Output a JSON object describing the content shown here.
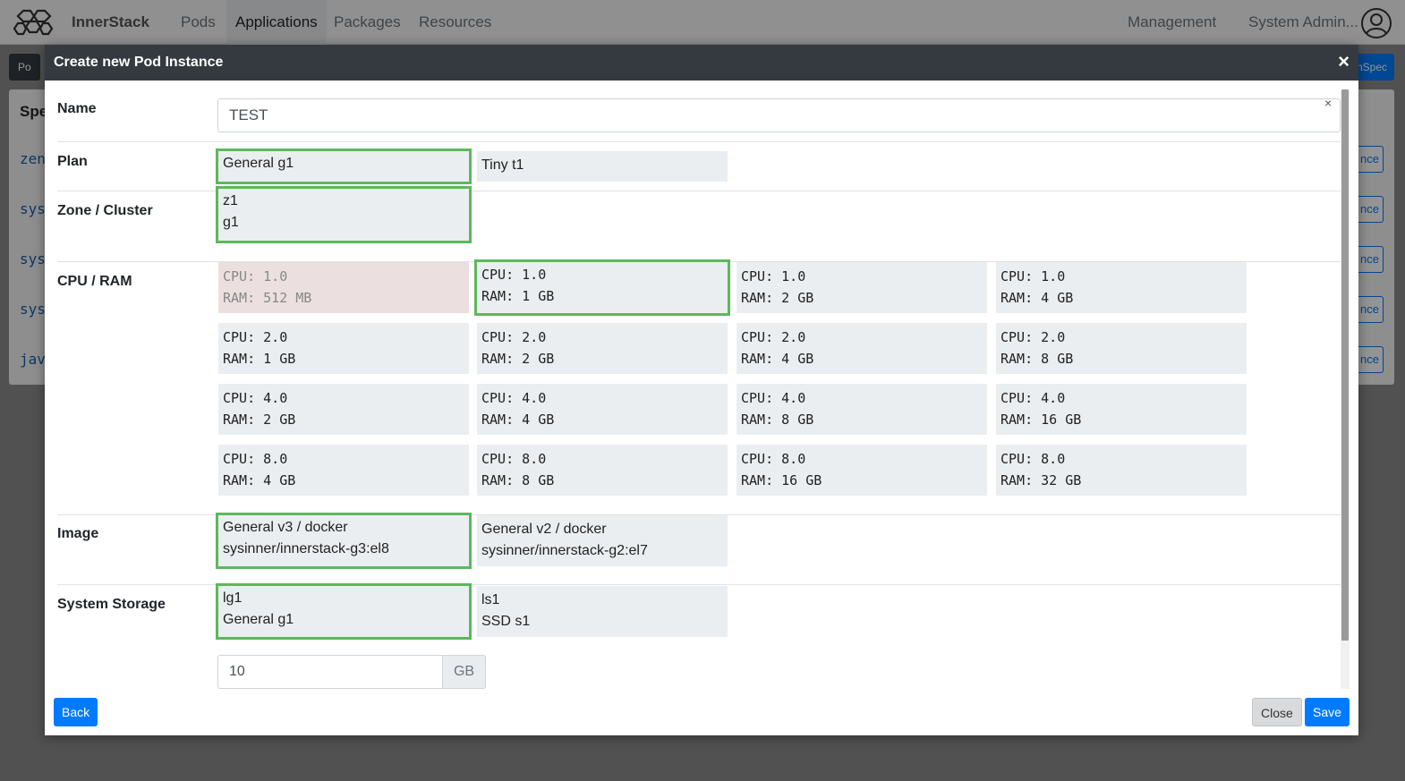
{
  "app": {
    "brand": "InnerStack",
    "nav": [
      "Pods",
      "Applications",
      "Packages",
      "Resources"
    ],
    "active_nav": "Applications",
    "right_nav": {
      "management": "Management",
      "user": "System Admin..."
    }
  },
  "background": {
    "chip_left": "Po",
    "chip_right": "nSpec",
    "section_head": "Spe",
    "rows": [
      "zen",
      "sys",
      "sys",
      "sys",
      "jav"
    ],
    "row_button": "nce"
  },
  "modal": {
    "title": "Create new Pod Instance",
    "close_glyph": "×",
    "name": {
      "label": "Name",
      "value": "TEST",
      "clear_glyph": "×"
    },
    "plan": {
      "label": "Plan",
      "options": [
        {
          "text": "General g1",
          "selected": true
        },
        {
          "text": "Tiny t1",
          "selected": false
        }
      ]
    },
    "zone": {
      "label": "Zone / Cluster",
      "options": [
        {
          "line1": "z1",
          "line2": "g1",
          "selected": true
        }
      ]
    },
    "cpu_ram": {
      "label": "CPU / RAM",
      "options": [
        {
          "cpu": "CPU: 1.0",
          "ram": "RAM: 512 MB",
          "state": "disabled"
        },
        {
          "cpu": "CPU: 1.0",
          "ram": "RAM: 1 GB",
          "state": "selected"
        },
        {
          "cpu": "CPU: 1.0",
          "ram": "RAM: 2 GB",
          "state": "normal"
        },
        {
          "cpu": "CPU: 1.0",
          "ram": "RAM: 4 GB",
          "state": "normal"
        },
        {
          "cpu": "CPU: 2.0",
          "ram": "RAM: 1 GB",
          "state": "normal"
        },
        {
          "cpu": "CPU: 2.0",
          "ram": "RAM: 2 GB",
          "state": "normal"
        },
        {
          "cpu": "CPU: 2.0",
          "ram": "RAM: 4 GB",
          "state": "normal"
        },
        {
          "cpu": "CPU: 2.0",
          "ram": "RAM: 8 GB",
          "state": "normal"
        },
        {
          "cpu": "CPU: 4.0",
          "ram": "RAM: 2 GB",
          "state": "normal"
        },
        {
          "cpu": "CPU: 4.0",
          "ram": "RAM: 4 GB",
          "state": "normal"
        },
        {
          "cpu": "CPU: 4.0",
          "ram": "RAM: 8 GB",
          "state": "normal"
        },
        {
          "cpu": "CPU: 4.0",
          "ram": "RAM: 16 GB",
          "state": "normal"
        },
        {
          "cpu": "CPU: 8.0",
          "ram": "RAM: 4 GB",
          "state": "normal"
        },
        {
          "cpu": "CPU: 8.0",
          "ram": "RAM: 8 GB",
          "state": "normal"
        },
        {
          "cpu": "CPU: 8.0",
          "ram": "RAM: 16 GB",
          "state": "normal"
        },
        {
          "cpu": "CPU: 8.0",
          "ram": "RAM: 32 GB",
          "state": "normal"
        }
      ]
    },
    "image": {
      "label": "Image",
      "options": [
        {
          "line1": "General v3 / docker",
          "line2": "sysinner/innerstack-g3:el8",
          "selected": true
        },
        {
          "line1": "General v2 / docker",
          "line2": "sysinner/innerstack-g2:el7",
          "selected": false
        }
      ]
    },
    "storage": {
      "label": "System Storage",
      "options": [
        {
          "line1": "lg1",
          "line2": "General g1",
          "selected": true
        },
        {
          "line1": "ls1",
          "line2": "SSD s1",
          "selected": false
        }
      ],
      "size_value": "10",
      "size_unit": "GB"
    },
    "footer": {
      "back": "Back",
      "close": "Close",
      "save": "Save"
    }
  }
}
